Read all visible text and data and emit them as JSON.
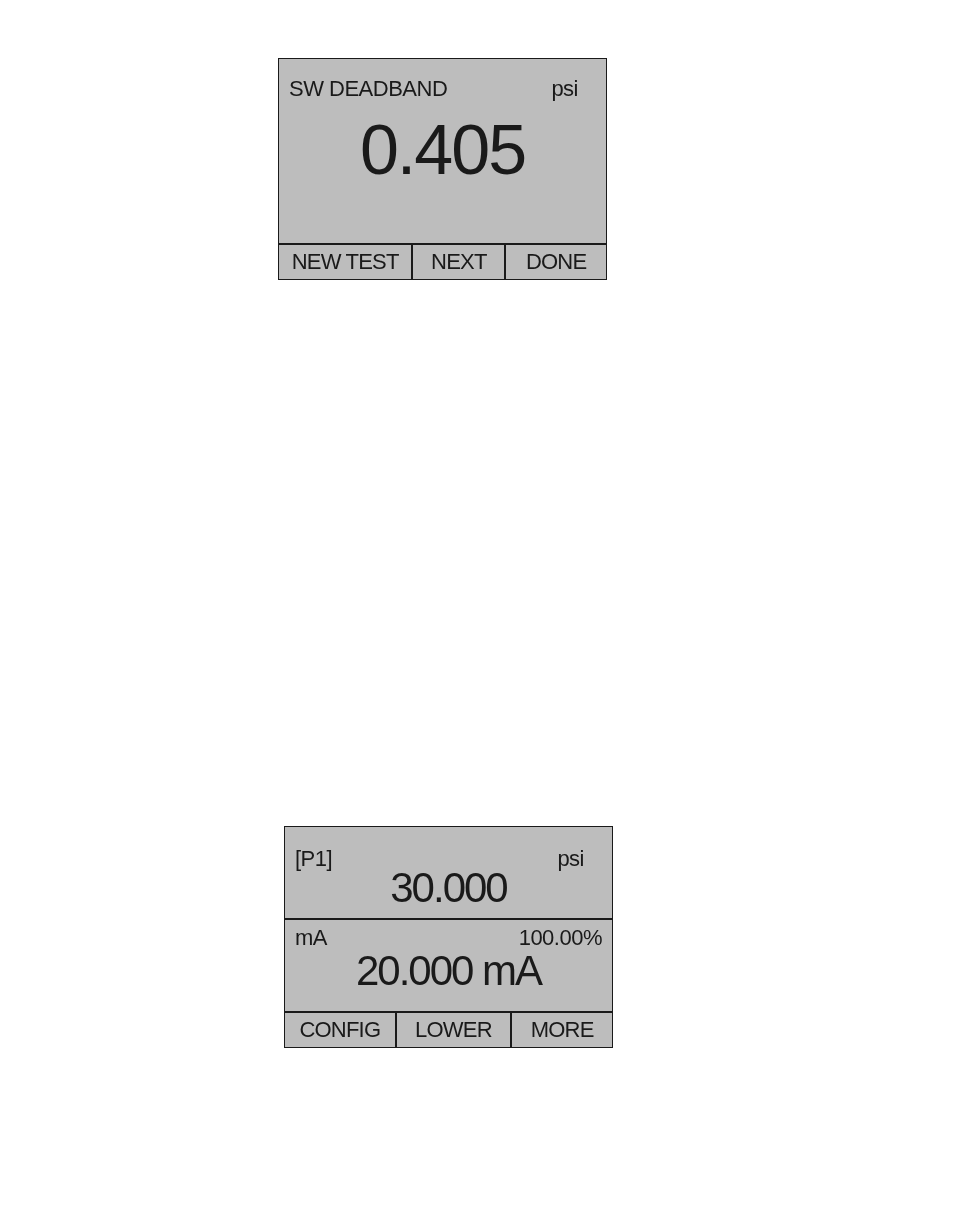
{
  "screens": [
    {
      "kind": "single",
      "title": "SW DEADBAND",
      "unit": "psi",
      "reading": "0.405",
      "softkeys": [
        "NEW TEST",
        "NEXT",
        "DONE"
      ]
    },
    {
      "kind": "dual",
      "upper": {
        "label": "[P1]",
        "unit": "psi",
        "reading": "30.000"
      },
      "lower": {
        "label": "mA",
        "percent": "100.00%",
        "reading": "20.000 mA"
      },
      "softkeys": [
        "CONFIG",
        "LOWER",
        "MORE"
      ]
    }
  ]
}
